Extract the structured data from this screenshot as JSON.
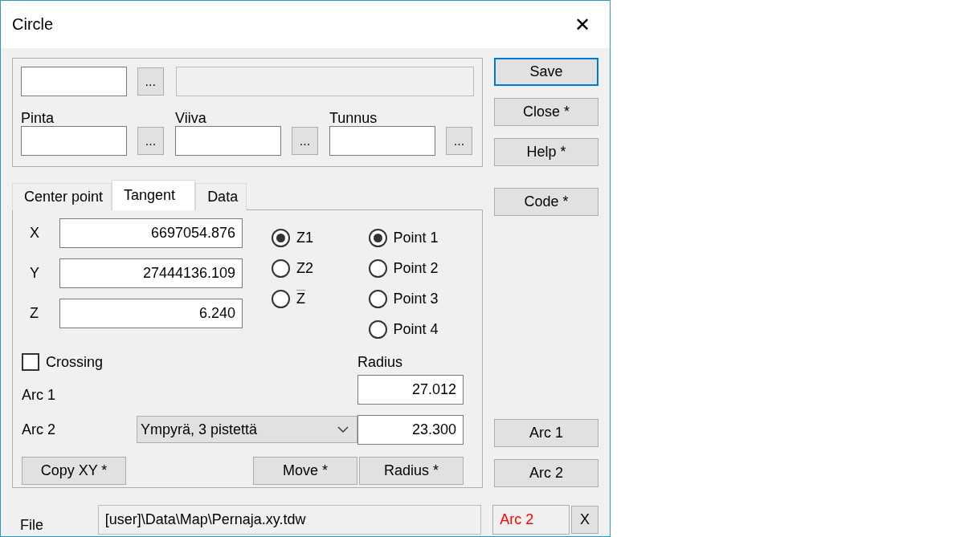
{
  "window": {
    "title": "Circle",
    "close": "✕"
  },
  "top_group": {
    "first_row": {
      "browse": "..."
    },
    "fields": [
      {
        "label": "Pinta",
        "browse": "..."
      },
      {
        "label": "Viiva",
        "browse": "..."
      },
      {
        "label": "Tunnus",
        "browse": "..."
      }
    ]
  },
  "side_buttons": [
    {
      "label": "Save",
      "default": true
    },
    {
      "label": "Close *",
      "default": false
    },
    {
      "label": "Help *",
      "default": false
    },
    {
      "label": "Code *",
      "default": false
    }
  ],
  "side_buttons_bottom": [
    {
      "label": "Arc 1"
    },
    {
      "label": "Arc 2"
    }
  ],
  "tabs": [
    {
      "label": "Center point",
      "selected": false
    },
    {
      "label": "Tangent",
      "selected": true
    },
    {
      "label": "Data",
      "selected": false
    }
  ],
  "coordinates": [
    {
      "label": "X",
      "value": "6697054.876"
    },
    {
      "label": "Y",
      "value": "27444136.109"
    },
    {
      "label": "Z",
      "value": "6.240"
    }
  ],
  "z_options": [
    {
      "label": "Z1",
      "overline": false,
      "selected": true
    },
    {
      "label": "Z2",
      "overline": false,
      "selected": false
    },
    {
      "label": "Z",
      "overline": true,
      "selected": false
    }
  ],
  "points": [
    {
      "label": "Point 1",
      "selected": true
    },
    {
      "label": "Point 2",
      "selected": false
    },
    {
      "label": "Point 3",
      "selected": false
    },
    {
      "label": "Point 4",
      "selected": false
    }
  ],
  "crossing": {
    "label": "Crossing",
    "checked": false
  },
  "radius": {
    "label": "Radius",
    "values": [
      "27.012",
      "23.300"
    ]
  },
  "arcs": [
    {
      "label": "Arc 1"
    },
    {
      "label": "Arc 2",
      "dropdown": "Ympyrä, 3 pistettä"
    }
  ],
  "panel_buttons": [
    "Copy XY *",
    "Move *",
    "Radius *"
  ],
  "file": {
    "label": "File",
    "value": "[user]\\Data\\Map\\Pernaja.xy.tdw",
    "status": "Arc 2",
    "clear": "X"
  }
}
